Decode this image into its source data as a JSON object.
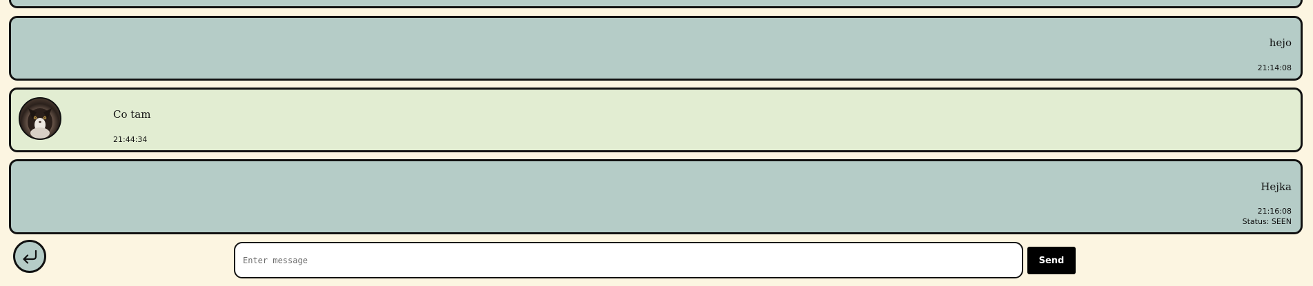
{
  "colors": {
    "page_background": "#fcf5e1",
    "own_message_background": "#b5ccc7",
    "other_message_background": "#e2edd2",
    "border": "#111111",
    "send_button_background": "#000000",
    "send_button_text": "#ffffff"
  },
  "messages": [
    {
      "sender": "self",
      "text": "",
      "time": ""
    },
    {
      "sender": "self",
      "text": "hejo",
      "time": "21:14:08"
    },
    {
      "sender": "other",
      "text": "Co tam",
      "time": "21:44:34",
      "avatar_icon": "cat-avatar"
    },
    {
      "sender": "self",
      "text": "Hejka",
      "time": "21:16:08",
      "status": "Status: SEEN"
    }
  ],
  "composer": {
    "back_icon": "return-arrow-icon",
    "placeholder": "Enter message",
    "value": "",
    "send_label": "Send"
  }
}
